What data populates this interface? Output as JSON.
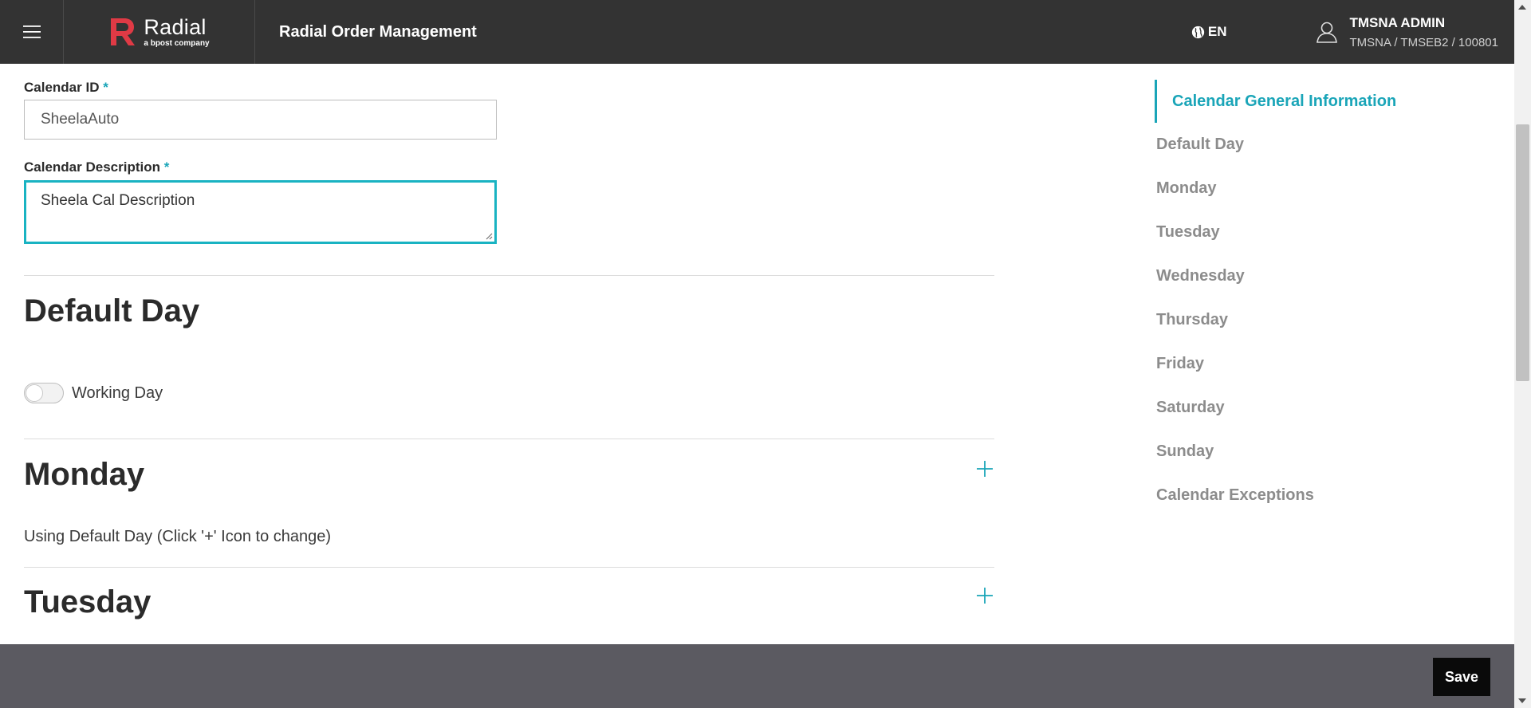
{
  "header": {
    "brand_name": "Radial",
    "brand_tagline": "a bpost company",
    "app_title": "Radial Order Management",
    "language": "EN",
    "user_name": "TMSNA ADMIN",
    "user_org": "TMSNA / TMSEB2 / 100801",
    "colors": {
      "bar": "#333333",
      "brand_red": "#e03a45"
    }
  },
  "form": {
    "calendar_id_label": "Calendar ID",
    "calendar_id_value": "SheelaAuto",
    "calendar_desc_label": "Calendar Description",
    "calendar_desc_value": "Sheela Cal Description",
    "required_mark": "*"
  },
  "sections": {
    "default_day": {
      "title": "Default Day",
      "toggle_label": "Working Day",
      "toggle_on": false
    },
    "monday": {
      "title": "Monday",
      "note": "Using Default Day (Click '+' Icon to change)"
    },
    "tuesday": {
      "title": "Tuesday"
    }
  },
  "side_nav": {
    "items": [
      "Calendar General Information",
      "Default Day",
      "Monday",
      "Tuesday",
      "Wednesday",
      "Thursday",
      "Friday",
      "Saturday",
      "Sunday",
      "Calendar Exceptions"
    ],
    "active_index": 0,
    "accent_color": "#1aa5b8"
  },
  "footer": {
    "save_label": "Save"
  }
}
